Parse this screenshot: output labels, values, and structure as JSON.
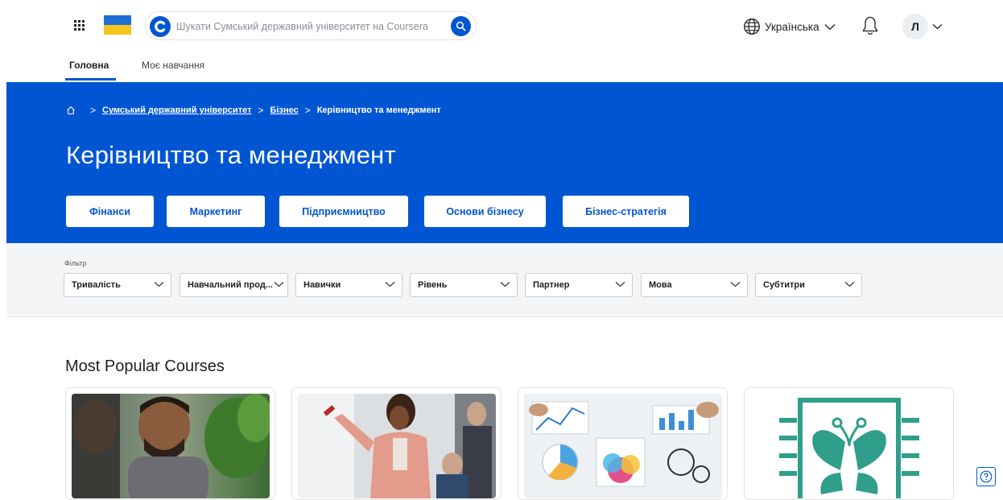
{
  "header": {
    "search_placeholder": "Шукати Сумський державний університет на Coursera",
    "language": "Українська",
    "avatar_letter": "Л"
  },
  "tabs": [
    "Головна",
    "Моє навчання"
  ],
  "breadcrumb": {
    "items": [
      "Сумський державний університет",
      "Бізнес"
    ],
    "current": "Керівництво та менеджмент"
  },
  "page_title": "Керівництво та менеджмент",
  "categories": [
    "Фінанси",
    "Маркетинг",
    "Підприємництво",
    "Основи бізнесу",
    "Бізнес-стратегія"
  ],
  "filters": {
    "label": "Фільтр",
    "items": [
      "Тривалість",
      "Навчальний прод...",
      "Навички",
      "Рівень",
      "Партнер",
      "Мова",
      "Субтитри"
    ]
  },
  "section_title": "Most Popular Courses",
  "colors": {
    "brand": "#0056d2",
    "banner": "#0056d2",
    "filter_bg": "#f4f5f7",
    "teal": "#2f9e8a"
  },
  "icons": [
    "apps-grid-icon",
    "ukraine-flag",
    "coursera-logo-icon",
    "search-icon",
    "globe-icon",
    "chevron-down-icon",
    "bell-icon",
    "home-icon",
    "help-icon"
  ]
}
